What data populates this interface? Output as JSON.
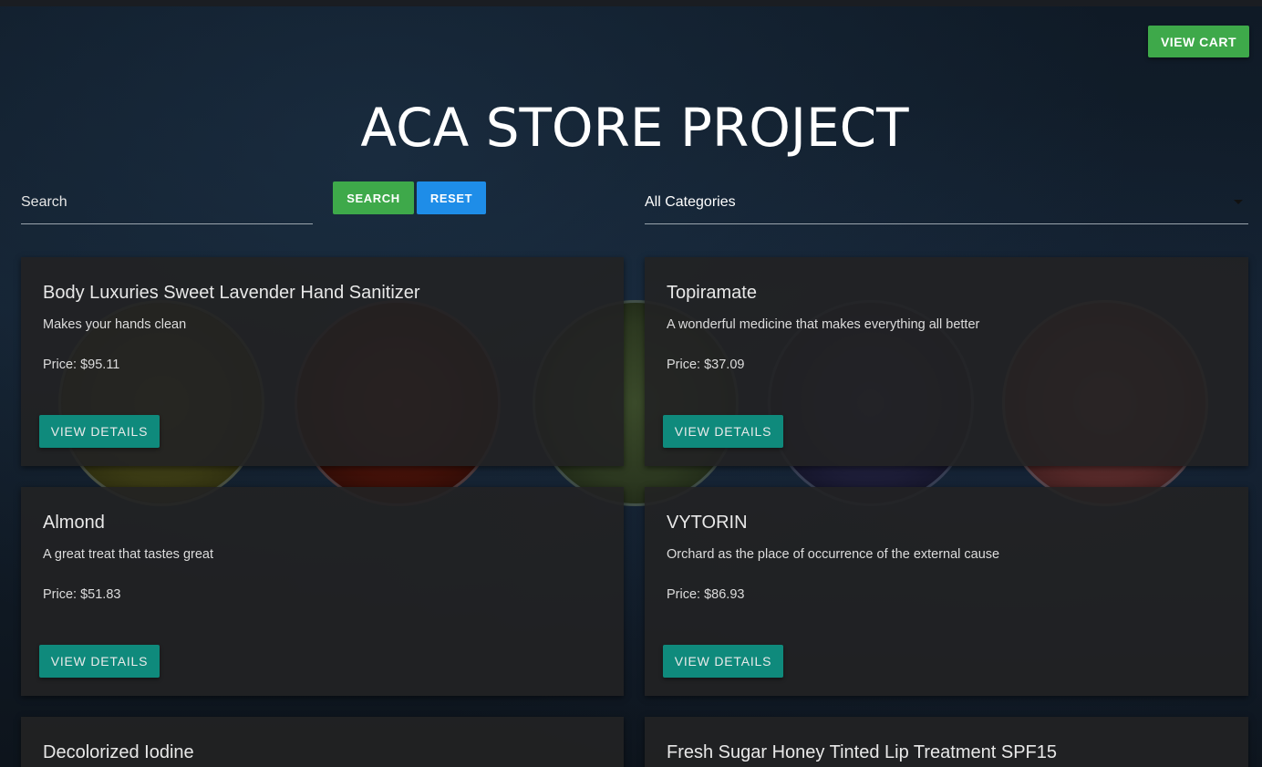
{
  "header": {
    "cart_label": "VIEW CART",
    "title": "ACA STORE PROJECT"
  },
  "controls": {
    "search_placeholder": "Search",
    "search_value": "",
    "search_button": "SEARCH",
    "reset_button": "RESET",
    "category_selected": "All Categories"
  },
  "colors": {
    "green": "#3ea94a",
    "blue": "#1e8de8",
    "teal": "#0f8a7c"
  },
  "products": [
    {
      "name": "Body Luxuries Sweet Lavender Hand Sanitizer",
      "description": "Makes your hands clean",
      "price": "Price: $95.11",
      "button": "VIEW DETAILS"
    },
    {
      "name": "Topiramate",
      "description": "A wonderful medicine that makes everything all better",
      "price": "Price: $37.09",
      "button": "VIEW DETAILS"
    },
    {
      "name": "Almond",
      "description": "A great treat that tastes great",
      "price": "Price: $51.83",
      "button": "VIEW DETAILS"
    },
    {
      "name": "VYTORIN",
      "description": "Orchard as the place of occurrence of the external cause",
      "price": "Price: $86.93",
      "button": "VIEW DETAILS"
    },
    {
      "name": "Decolorized Iodine"
    },
    {
      "name": "Fresh Sugar Honey Tinted Lip Treatment SPF15"
    }
  ]
}
